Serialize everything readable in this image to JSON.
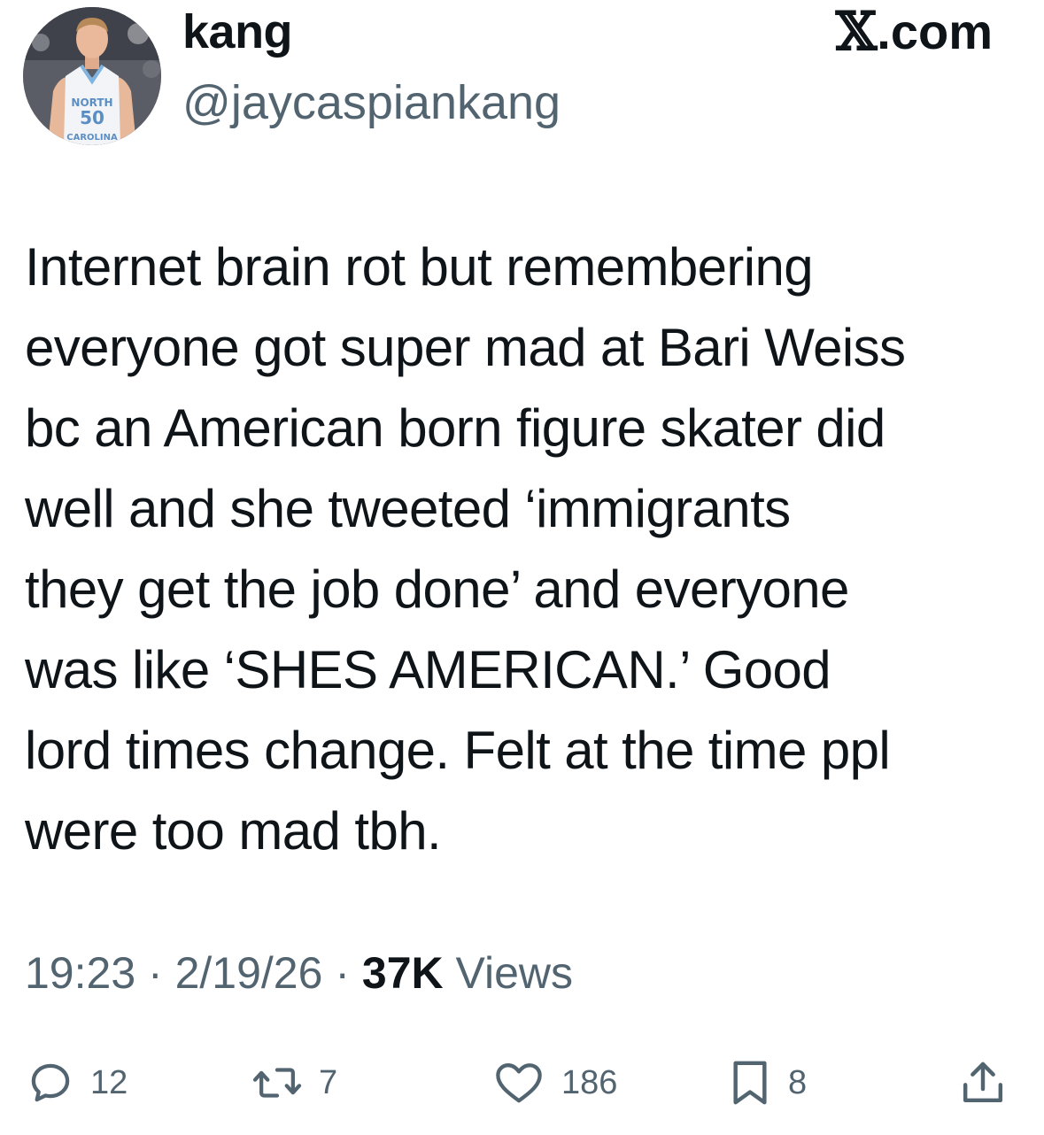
{
  "header": {
    "display_name": "kang",
    "handle": "@jaycaspiankang",
    "brand": ".com",
    "jersey_text": "NORTH",
    "jersey_number": "50",
    "jersey_bottom": "CAROLINA"
  },
  "tweet": {
    "lines": [
      "Internet brain rot but remembering",
      "everyone got super mad at Bari Weiss",
      "bc an American born figure skater did",
      "well and she tweeted ‘immigrants",
      "they get the job done’ and everyone",
      "was like ‘SHES AMERICAN.’ Good",
      "lord times change. Felt at the time ppl",
      "were too mad tbh."
    ]
  },
  "meta": {
    "time": "19:23",
    "separator": "·",
    "date": "2/19/26",
    "views_count": "37K",
    "views_label": "Views"
  },
  "actions": {
    "replies": "12",
    "reposts": "7",
    "likes": "186",
    "bookmarks": "8"
  },
  "icons": {
    "reply": "reply-icon",
    "repost": "repost-icon",
    "like": "heart-icon",
    "bookmark": "bookmark-icon",
    "share": "share-icon",
    "brand": "x-logo-icon"
  },
  "colors": {
    "text": "#0f1419",
    "secondary": "#536471",
    "background": "#ffffff"
  }
}
